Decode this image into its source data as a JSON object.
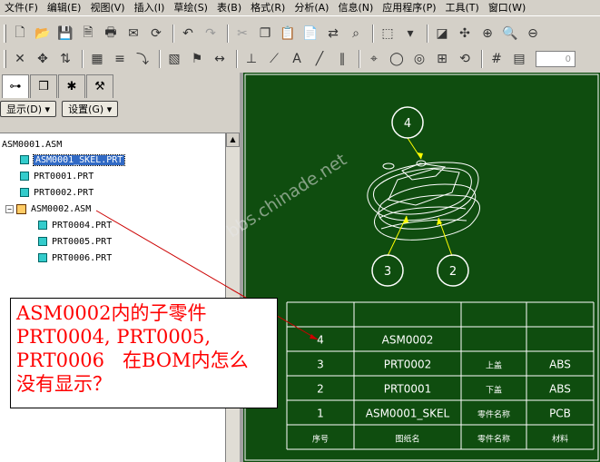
{
  "menu": [
    "文件(F)",
    "编辑(E)",
    "视图(V)",
    "插入(I)",
    "草绘(S)",
    "表(B)",
    "格式(R)",
    "分析(A)",
    "信息(N)",
    "应用程序(P)",
    "工具(T)",
    "窗口(W)"
  ],
  "toolbar1_icons": [
    "new-icon",
    "open-icon",
    "save-icon",
    "print-preview-icon",
    "print-icon",
    "mail-icon",
    "refresh-icon",
    "undo-icon",
    "redo-icon",
    "cut-icon",
    "copy-icon",
    "paste-icon",
    "paste-special-icon",
    "regenerate-icon",
    "binoculars-icon",
    "select-box-icon",
    "dropdown-arrow-icon",
    "datum-display-icon",
    "spin-center-icon",
    "zoom-fit-icon",
    "zoom-in-icon",
    "zoom-out-icon"
  ],
  "toolbar2_icons": [
    "delete-icon",
    "move-icon",
    "regen-arrow-icon",
    "insert-table-icon",
    "insert-note-icon",
    "wrap-icon",
    "hatch-icon",
    "symbol-icon",
    "dimension-icon",
    "ordinate-icon",
    "leader-icon",
    "text-style-icon",
    "line-style-icon",
    "parallel-line-icon",
    "gtol-icon",
    "balloon-icon",
    "bom-balloon-icon",
    "table-icon",
    "repeat-region-icon",
    "grid-icon",
    "table-edit-icon"
  ],
  "toolbar2_spin": {
    "value": "0"
  },
  "nav_tabs": [
    "model-tree-tab",
    "layers-tab",
    "favorites-tab",
    "connections-tab"
  ],
  "nav_buttons": {
    "display": "显示(D)",
    "settings": "设置(G)"
  },
  "tree": {
    "root": "ASM0001.ASM",
    "items": [
      {
        "label": "ASM0001_SKEL.PRT",
        "type": "skel",
        "selected": true
      },
      {
        "label": "PRT0001.PRT",
        "type": "part"
      },
      {
        "label": "PRT0002.PRT",
        "type": "part"
      },
      {
        "label": "ASM0002.ASM",
        "type": "asm",
        "expander": "−"
      },
      {
        "label": "PRT0004.PRT",
        "type": "part"
      },
      {
        "label": "PRT0005.PRT",
        "type": "part"
      },
      {
        "label": "PRT0006.PRT",
        "type": "part"
      }
    ]
  },
  "balloons": [
    "4",
    "3",
    "2"
  ],
  "bom": {
    "rows": [
      [
        "4",
        "ASM0002",
        "",
        ""
      ],
      [
        "3",
        "PRT0002",
        "上盖",
        "ABS"
      ],
      [
        "2",
        "PRT0001",
        "下盖",
        "ABS"
      ],
      [
        "1",
        "ASM0001_SKEL",
        "零件名称",
        "PCB"
      ]
    ],
    "header": [
      "序号",
      "图纸名",
      "零件名称",
      "材料"
    ]
  },
  "callout": "ASM0002内的子零件\nPRT0004, PRT0005,\nPRT0006   在BOM内怎么\n没有显示？",
  "watermark": "bbs.chinade.net",
  "colors": {
    "canvas": "#0f4d0f",
    "line": "#ffffff",
    "balloon_leader": "#ffff00",
    "callout_text": "#ff0000",
    "arrow": "#cc0000"
  }
}
